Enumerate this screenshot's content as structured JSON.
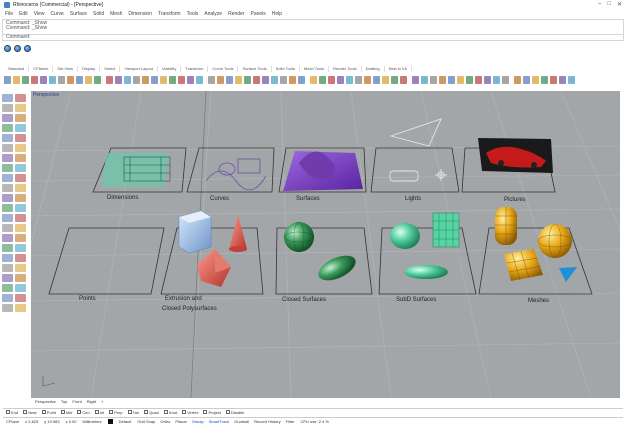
{
  "window": {
    "title": "Rhinoceros (Commercial) - [Perspective]"
  },
  "menu": [
    "File",
    "Edit",
    "View",
    "Curve",
    "Surface",
    "Solid",
    "Mesh",
    "Dimension",
    "Transform",
    "Tools",
    "Analyze",
    "Render",
    "Panels",
    "Help"
  ],
  "command": {
    "history": [
      "Command: _Show",
      "Command: _Show"
    ],
    "prompt": "Command:"
  },
  "toolbar_tabs": [
    "Standard",
    "CPlanes",
    "Set View",
    "Display",
    "Select",
    "Viewport Layout",
    "Visibility",
    "Transform",
    "Curve Tools",
    "Surface Tools",
    "Solid Tools",
    "Mesh Tools",
    "Render Tools",
    "Drafting",
    "New in V6"
  ],
  "viewport": {
    "label": "Perspective",
    "panels_top": [
      "Dimensions",
      "Curves",
      "Surfaces",
      "Lights",
      "Pictures"
    ],
    "panels_bottom": [
      "Points",
      "Extrusion and",
      "Closed Polysurfaces",
      "Closed Surfaces",
      "SubD Surfaces",
      "Meshes"
    ]
  },
  "view_tabs": [
    "Perspective",
    "Top",
    "Front",
    "Right",
    "+"
  ],
  "osnaps": [
    "End",
    "Near",
    "Point",
    "Mid",
    "Cen",
    "Int",
    "Perp",
    "Tan",
    "Quad",
    "Knot",
    "Vertex",
    "Project",
    "Disable"
  ],
  "status": {
    "cplane": "CPlane",
    "x": "x 2.825",
    "y": "y 10.983",
    "z": "z 0.00",
    "units": "Millimeters",
    "layer": "Default",
    "toggles": [
      "Grid Snap",
      "Ortho",
      "Planar",
      "Osnap",
      "SmartTrack",
      "Gumball",
      "Record History",
      "Filter"
    ],
    "toggles_on": [
      "Osnap",
      "SmartTrack"
    ],
    "memory": "CPU use: 2.4 %"
  },
  "colors": {
    "viewport_bg": "#a3a6a8",
    "surface_purple": "#7b3fbf",
    "primitive_blue": "#8fb8e0",
    "primitive_red": "#d9534f",
    "sphere_green": "#3a9a5a",
    "mesh_yellow": "#e8a817",
    "subd_green": "#4fc99a"
  },
  "icons": [
    "rhino-logo-icon",
    "minimize-icon",
    "maximize-icon",
    "close-icon",
    "standard-toolbar-icon",
    "left-toolbar-icon",
    "world-axes-icon"
  ]
}
